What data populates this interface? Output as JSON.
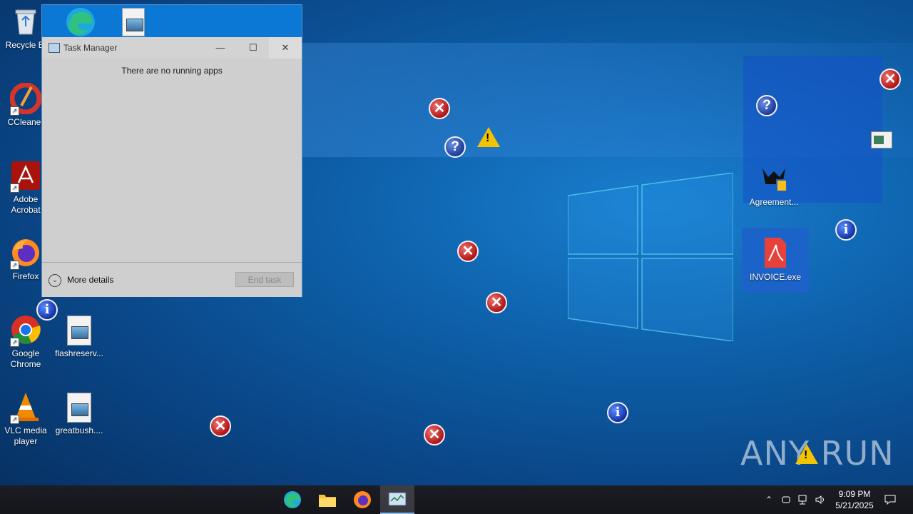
{
  "desktop_icons": {
    "recycle_bin": "Recycle Bi",
    "ccleaner": "CCleaner",
    "acrobat_line1": "Adobe",
    "acrobat_line2": "Acrobat",
    "firefox": "Firefox",
    "chrome_line1": "Google",
    "chrome_line2": "Chrome",
    "vlc_line1": "VLC media",
    "vlc_line2": "player",
    "flashreserv": "flashreserv...",
    "greatbush": "greatbush....",
    "agreement": "Agreement...",
    "invoice": "INVOICE.exe"
  },
  "task_manager": {
    "title": "Task Manager",
    "empty_message": "There are no running apps",
    "more_details": "More details",
    "end_task": "End task",
    "minimize_glyph": "—",
    "maximize_glyph": "☐",
    "close_glyph": "✕"
  },
  "taskbar": {
    "time": "9:09 PM",
    "date": "5/21/2025"
  },
  "watermark": "ANY RUN",
  "colors": {
    "taskbar_bg": "#15151c",
    "accent_blue": "#0a78d4",
    "error_red": "#b01515",
    "info_blue": "#1232a8",
    "warn_yellow": "#f2c300"
  }
}
